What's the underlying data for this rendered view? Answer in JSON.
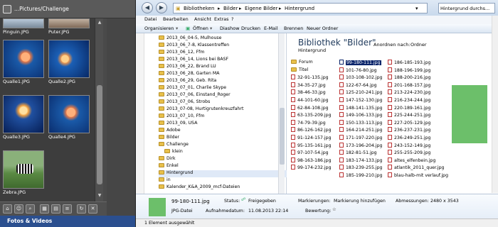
{
  "gallery": {
    "path": "...Pictures/Challenge",
    "thumbs": [
      {
        "caption": "Pinguin.JPG"
      },
      {
        "caption": "Puter.JPG"
      },
      {
        "caption": "Qualle1.JPG"
      },
      {
        "caption": "Qualle2.JPG"
      },
      {
        "caption": "Qualle3.JPG"
      },
      {
        "caption": "Qualle4.JPG"
      },
      {
        "caption": "Zebra.JPG"
      }
    ],
    "tab_label": "Fotos & Videos"
  },
  "explorer": {
    "breadcrumb": [
      "Bibliotheken",
      "Bilder",
      "Eigene Bilder",
      "Hintergrund"
    ],
    "search_placeholder": "Hintergrund durchs...",
    "menu": [
      "Datei",
      "Bearbeiten",
      "Ansicht",
      "Extras",
      "?"
    ],
    "toolbar": [
      "Organisieren",
      "Öffnen",
      "Diashow",
      "Drucken",
      "E-Mail",
      "Brennen",
      "Neuer Ordner"
    ],
    "tree": [
      "2013_06_04-5, Mulhouse",
      "2013_06_7-8, Klassentreffen",
      "2013_06_12, Ffm",
      "2013_06_14, Lions bei BASF",
      "2013_06_22, Brand LU",
      "2013_06_28, Garten MA",
      "2013_06_29, Geb. Rita",
      "2013_07_01, Charlie Skype",
      "2013_07_06, Einstand_Roger",
      "2013_07_06, Strobs",
      "2013_07-08, Hurtigrutenkreuzfahrt",
      "2013_07_10, Ffm",
      "2013_09, USA",
      "Adobe",
      "Bilder",
      "Challenge",
      "klein",
      "Dirk",
      "Enkel",
      "Hintergrund",
      "in",
      "Kalender_K&A_2009_mcf-Dateien"
    ],
    "library_title": "Bibliothek \"Bilder\"",
    "library_subtitle": "Hintergrund",
    "arrange_label": "Anordnen nach:",
    "arrange_value": "Ordner",
    "col1": [
      "Forum",
      "Titel",
      "32-91-135.jpg",
      "34-35-27.jpg",
      "38-46-33.jpg",
      "44-101-60.jpg",
      "62-84-108.jpg",
      "63-135-209.jpg",
      "74-79-39.jpg",
      "86-126-162.jpg",
      "91-124-157.jpg",
      "95-135-161.jpg",
      "97-107-54.jpg",
      "98-163-186.jpg",
      "99-174-232.jpg"
    ],
    "col2": [
      "99-180-111.jpg",
      "101-76-80.jpg",
      "103-108-102.jpg",
      "122-67-64.jpg",
      "125-210-241.jpg",
      "147-152-130.jpg",
      "148-141-135.jpg",
      "149-106-133.jpg",
      "150-133-113.jpg",
      "164-214-251.jpg",
      "171-197-220.jpg",
      "173-196-204.jpg",
      "182-81-51.jpg",
      "183-174-133.jpg",
      "183-239-255.jpg",
      "185-199-210.jpg"
    ],
    "col3": [
      "186-185-193.jpg",
      "188-196-199.jpg",
      "188-200-216.jpg",
      "201-168-157.jpg",
      "213-224-230.jpg",
      "216-234-244.jpg",
      "220-189-161.jpg",
      "225-244-251.jpg",
      "227-205-129.jpg",
      "236-237-231.jpg",
      "236-249-251.jpg",
      "243-152-149.jpg",
      "255-255-209.jpg",
      "altes_elfenbein.jpg",
      "atlantik_2011_quer.jpg",
      "blau-halb-mit verlauf.jpg"
    ],
    "details": {
      "filename": "99-180-111.jpg",
      "filetype": "JPG-Datei",
      "status_label": "Status:",
      "status_value": "Freigegeben",
      "date_label": "Aufnahmedatum:",
      "date_value": "11.08.2013 22:14",
      "tags_label": "Markierungen:",
      "tags_value": "Markierung hinzufügen",
      "rating_label": "Bewertung:",
      "dims_label": "Abmessungen:",
      "dims_value": "2480 x 3543"
    },
    "status_bar": "1 Element ausgewählt"
  }
}
